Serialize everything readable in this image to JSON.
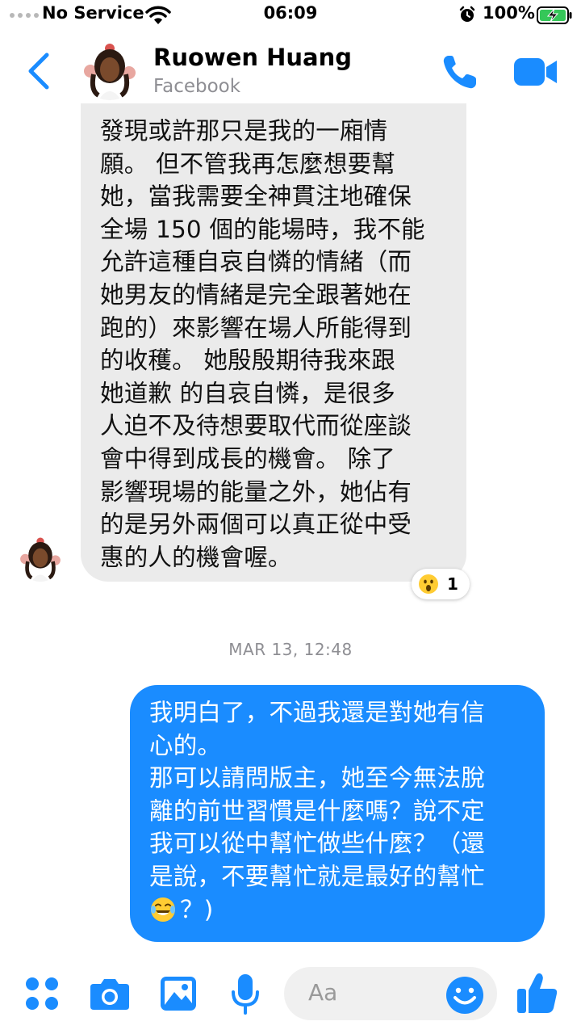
{
  "status_bar": {
    "carrier": "No Service",
    "time": "06:09",
    "battery": "100%"
  },
  "header": {
    "contact_name": "Ruowen Huang",
    "contact_subtitle": "Facebook",
    "icons": [
      "back-chevron-icon",
      "phone-icon",
      "video-camera-icon"
    ]
  },
  "conversation": {
    "incoming_message": {
      "lines": [
        "發現或許那只是我的一廂情",
        "願。 但不管我再怎麼想要幫",
        "她，當我需要全神貫注地確保",
        "全場 150 個的能場時，我不能",
        "允許這種自哀自憐的情緒（而",
        "她男友的情緒是完全跟著她在",
        "跑的）來影響在場人所能得到",
        "的收穫。 她殷殷期待我來跟",
        "她道歉 的自哀自憐，是很多",
        "人迫不及待想要取代而從座談",
        "會中得到成長的機會。 除了",
        "影響現場的能量之外，她佔有",
        "的是另外兩個可以真正從中受",
        "惠的人的機會喔。"
      ],
      "reaction": {
        "emoji": "surprised-face-icon",
        "count": "1"
      }
    },
    "timestamp": "MAR 13, 12:48",
    "outgoing_message": {
      "lines": [
        "我明白了，不過我還是對她有信",
        "心的。",
        "那可以請問版主，她至今無法脫",
        "離的前世習慣是什麼嗎？說不定",
        "我可以從中幫忙做些什麼？（還",
        "是說，不要幫忙就是最好的幫忙"
      ],
      "last_line_suffix": "？)",
      "last_line_emoji": "tears-of-joy-icon"
    }
  },
  "composer": {
    "placeholder": "Aa",
    "buttons": [
      "menu-dots-icon",
      "camera-icon",
      "photo-icon",
      "microphone-icon",
      "emoji-icon",
      "thumbs-up-icon"
    ]
  },
  "colors": {
    "accent": "#1a8cff",
    "incoming_bubble": "#ebebeb",
    "secondary_text": "#8e8e93"
  }
}
